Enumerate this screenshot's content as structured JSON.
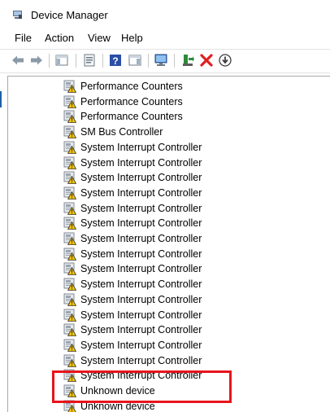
{
  "window": {
    "title": "Device Manager"
  },
  "menu": [
    {
      "label": "File"
    },
    {
      "label": "Action"
    },
    {
      "label": "View"
    },
    {
      "label": "Help"
    }
  ],
  "toolbar": {
    "buttons": [
      {
        "icon": "back-arrow-icon"
      },
      {
        "icon": "forward-arrow-icon"
      },
      {
        "icon": "show-hide-console-tree-icon"
      },
      {
        "icon": "properties-icon"
      },
      {
        "icon": "help-icon"
      },
      {
        "icon": "action-pane-icon"
      },
      {
        "icon": "scan-hardware-changes-icon"
      },
      {
        "icon": "update-driver-icon"
      },
      {
        "icon": "uninstall-device-icon"
      },
      {
        "icon": "download-driver-icon"
      }
    ]
  },
  "tree": {
    "items": [
      {
        "label": "Performance Counters"
      },
      {
        "label": "Performance Counters"
      },
      {
        "label": "Performance Counters"
      },
      {
        "label": "SM Bus Controller"
      },
      {
        "label": "System Interrupt Controller"
      },
      {
        "label": "System Interrupt Controller"
      },
      {
        "label": "System Interrupt Controller"
      },
      {
        "label": "System Interrupt Controller"
      },
      {
        "label": "System Interrupt Controller"
      },
      {
        "label": "System Interrupt Controller"
      },
      {
        "label": "System Interrupt Controller"
      },
      {
        "label": "System Interrupt Controller"
      },
      {
        "label": "System Interrupt Controller"
      },
      {
        "label": "System Interrupt Controller"
      },
      {
        "label": "System Interrupt Controller"
      },
      {
        "label": "System Interrupt Controller"
      },
      {
        "label": "System Interrupt Controller"
      },
      {
        "label": "System Interrupt Controller"
      },
      {
        "label": "System Interrupt Controller"
      },
      {
        "label": "System Interrupt Controller"
      },
      {
        "label": "Unknown device"
      },
      {
        "label": "Unknown device"
      }
    ]
  },
  "colors": {
    "highlight": "#e8141b",
    "warning": "#f3c400"
  }
}
